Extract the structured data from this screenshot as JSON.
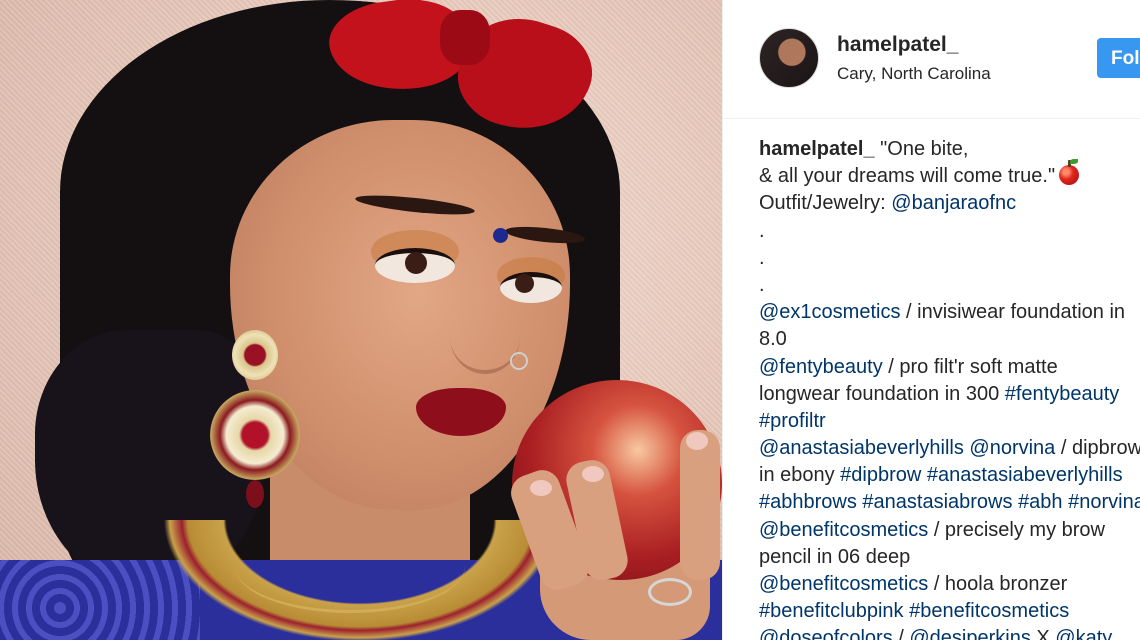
{
  "post": {
    "username": "hamelpatel_",
    "location": "Cary, North Carolina",
    "follow_label": "Follow",
    "apple_emoji": "apple-emoji",
    "caption_lines": [
      [
        {
          "t": "hamelpatel_",
          "type": "user"
        },
        {
          "t": " \"One bite,",
          "type": "text"
        }
      ],
      [
        {
          "t": "& all your dreams will come true.\"",
          "type": "text"
        },
        {
          "t": "",
          "type": "emoji"
        }
      ],
      [
        {
          "t": "Outfit/Jewelry: ",
          "type": "text"
        },
        {
          "t": "@banjaraofnc",
          "type": "link"
        }
      ],
      [
        {
          "t": ".",
          "type": "text"
        }
      ],
      [
        {
          "t": ".",
          "type": "text"
        }
      ],
      [
        {
          "t": ".",
          "type": "text"
        }
      ],
      [
        {
          "t": "@ex1cosmetics",
          "type": "link"
        },
        {
          "t": " / invisiwear foundation in",
          "type": "text"
        }
      ],
      [
        {
          "t": "8.0",
          "type": "text"
        }
      ],
      [
        {
          "t": "@fentybeauty",
          "type": "link"
        },
        {
          "t": " / pro filt'r soft matte",
          "type": "text"
        }
      ],
      [
        {
          "t": "longwear foundation in 300 ",
          "type": "text"
        },
        {
          "t": "#fentybeauty",
          "type": "link"
        }
      ],
      [
        {
          "t": "#profiltr",
          "type": "link"
        }
      ],
      [
        {
          "t": "@anastasiabeverlyhills",
          "type": "link"
        },
        {
          "t": " ",
          "type": "text"
        },
        {
          "t": "@norvina",
          "type": "link"
        },
        {
          "t": " / dipbrow",
          "type": "text"
        }
      ],
      [
        {
          "t": "in ebony ",
          "type": "text"
        },
        {
          "t": "#dipbrow",
          "type": "link"
        },
        {
          "t": " ",
          "type": "text"
        },
        {
          "t": "#anastasiabeverlyhills",
          "type": "link"
        }
      ],
      [
        {
          "t": "#abhbrows",
          "type": "link"
        },
        {
          "t": " ",
          "type": "text"
        },
        {
          "t": "#anastasiabrows",
          "type": "link"
        },
        {
          "t": " ",
          "type": "text"
        },
        {
          "t": "#abh",
          "type": "link"
        },
        {
          "t": " ",
          "type": "text"
        },
        {
          "t": "#norvina",
          "type": "link"
        }
      ],
      [
        {
          "t": "@benefitcosmetics",
          "type": "link"
        },
        {
          "t": " / precisely my brow",
          "type": "text"
        }
      ],
      [
        {
          "t": "pencil in 06 deep",
          "type": "text"
        }
      ],
      [
        {
          "t": "@benefitcosmetics",
          "type": "link"
        },
        {
          "t": " / hoola bronzer",
          "type": "text"
        }
      ],
      [
        {
          "t": "#benefitclubpink",
          "type": "link"
        },
        {
          "t": " ",
          "type": "text"
        },
        {
          "t": "#benefitcosmetics",
          "type": "link"
        }
      ],
      [
        {
          "t": "@doseofcolors",
          "type": "link"
        },
        {
          "t": " / ",
          "type": "text"
        },
        {
          "t": "@desiperkins",
          "type": "link"
        },
        {
          "t": " X ",
          "type": "text"
        },
        {
          "t": "@katy",
          "type": "link"
        }
      ]
    ]
  },
  "colors": {
    "follow_bg": "#3897f0",
    "link": "#003569",
    "text": "#262626"
  }
}
